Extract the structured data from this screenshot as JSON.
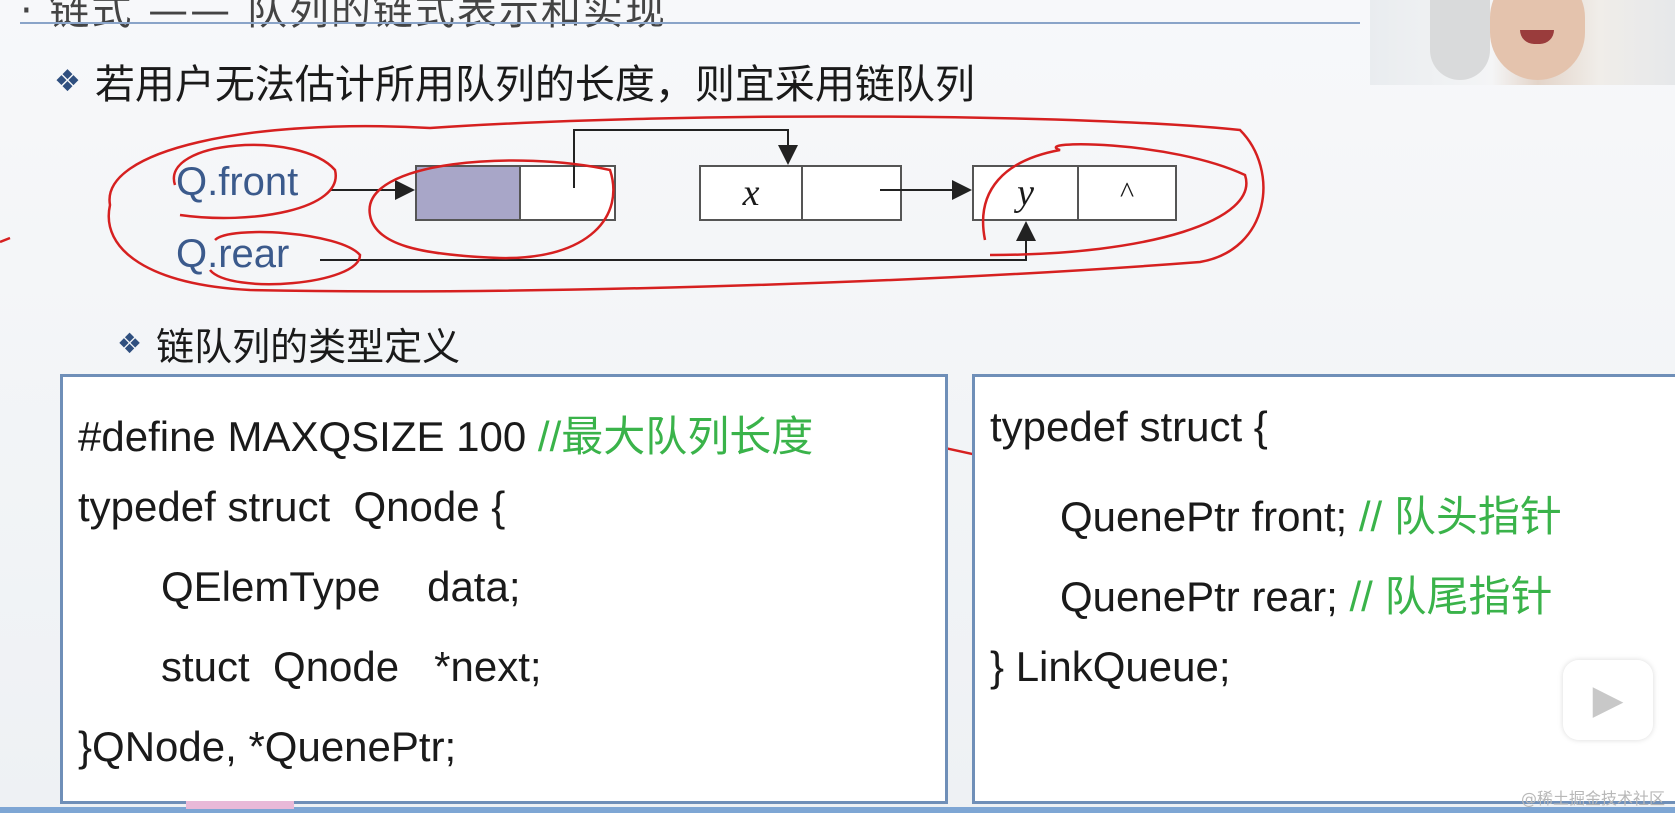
{
  "slide": {
    "title_partial": "· 链式 —— 队列的链式表示和实现",
    "bullet_main": "若用户无法估计所用队列的长度，则宜采用链队列",
    "bullet_sub": "链队列的类型定义",
    "bullet_icon": "diamond-bullet-icon"
  },
  "diagram": {
    "front_label": "Q.front",
    "rear_label": "Q.rear",
    "node1_data": "x",
    "node2_data": "y",
    "null_pointer": "^",
    "head_fill_color": "#a8a6c8",
    "annotation_color": "#d62020"
  },
  "code_left": {
    "line1_code": "#define MAXQSIZE 100 ",
    "line1_comment": "//最大队列长度",
    "line2": "typedef struct  Qnode {",
    "line3": "QElemType    data;",
    "line4": "stuct  Qnode   *next;",
    "line5": "}QNode, *QuenePtr;"
  },
  "code_right": {
    "line1": "typedef struct {",
    "line2_code": "QuenePtr front; ",
    "line2_comment": "// 队头指针",
    "line3_code": "QuenePtr rear; ",
    "line3_comment": "// 队尾指针",
    "line4": "} LinkQueue;"
  },
  "overlay": {
    "watermark": "@稀土掘金技术社区",
    "play_icon": "play-icon",
    "comment_color": "#3ab34a",
    "border_color": "#6f8fb8"
  }
}
